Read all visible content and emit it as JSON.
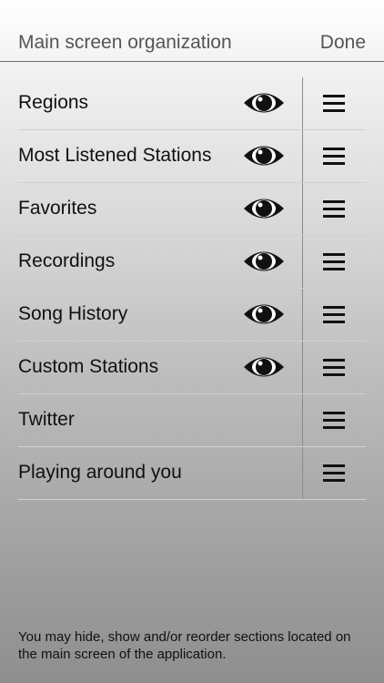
{
  "header": {
    "title": "Main screen organization",
    "done_label": "Done"
  },
  "sections": [
    {
      "label": "Regions",
      "visible": true
    },
    {
      "label": "Most Listened Stations",
      "visible": true
    },
    {
      "label": "Favorites",
      "visible": true
    },
    {
      "label": "Recordings",
      "visible": true
    },
    {
      "label": "Song History",
      "visible": true
    },
    {
      "label": "Custom Stations",
      "visible": true
    },
    {
      "label": "Twitter",
      "visible": false
    },
    {
      "label": "Playing around you",
      "visible": false
    }
  ],
  "icons": {
    "visibility": "eye-icon",
    "reorder": "reorder-handle-icon"
  },
  "footer": {
    "note": "You may hide, show and/or reorder sections located on the main screen of the application."
  }
}
